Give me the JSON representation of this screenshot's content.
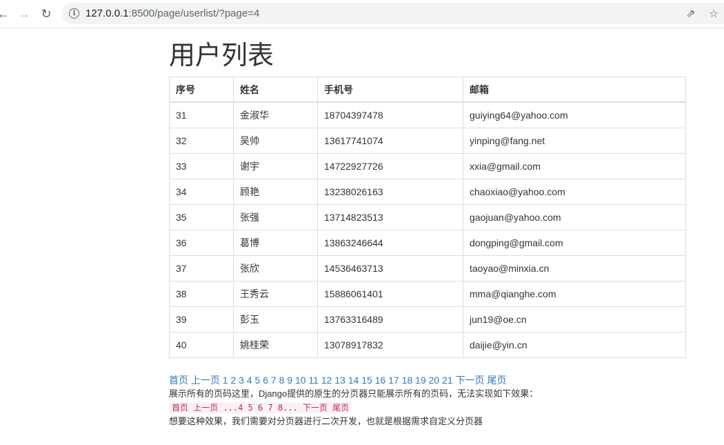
{
  "browser": {
    "url_host": "127.0.0.1",
    "url_rest": ":8500/page/userlist/?page=4"
  },
  "page": {
    "title": "用户列表",
    "table": {
      "headers": [
        "序号",
        "姓名",
        "手机号",
        "邮箱"
      ],
      "rows": [
        [
          "31",
          "金淑华",
          "18704397478",
          "guiying64@yahoo.com"
        ],
        [
          "32",
          "吴帅",
          "13617741074",
          "yinping@fang.net"
        ],
        [
          "33",
          "谢宇",
          "14722927726",
          "xxia@gmail.com"
        ],
        [
          "34",
          "顾艳",
          "13238026163",
          "chaoxiao@yahoo.com"
        ],
        [
          "35",
          "张强",
          "13714823513",
          "gaojuan@yahoo.com"
        ],
        [
          "36",
          "葛博",
          "13863246644",
          "dongping@gmail.com"
        ],
        [
          "37",
          "张欣",
          "14536463713",
          "taoyao@minxia.cn"
        ],
        [
          "38",
          "王秀云",
          "15886061401",
          "mma@qianghe.com"
        ],
        [
          "39",
          "彭玉",
          "13763316489",
          "jun19@oe.cn"
        ],
        [
          "40",
          "姚桂荣",
          "13078917832",
          "daijie@yin.cn"
        ]
      ]
    },
    "pager": {
      "first": "首页",
      "prev": "上一页",
      "pages": [
        "1",
        "2",
        "3",
        "4",
        "5",
        "6",
        "7",
        "8",
        "9",
        "10",
        "11",
        "12",
        "13",
        "14",
        "15",
        "16",
        "17",
        "18",
        "19",
        "20",
        "21"
      ],
      "next": "下一页",
      "last": "尾页"
    },
    "desc1": "展示所有的页码这里，Django提供的原生的分页器只能展示所有的页码，无法实现如下效果：",
    "example_code": "首页 上一页 ...4 5 6 7 8... 下一页 尾页",
    "desc2": "想要这种效果，我们需要对分页器进行二次开发，也就是根据需求自定义分页器"
  }
}
